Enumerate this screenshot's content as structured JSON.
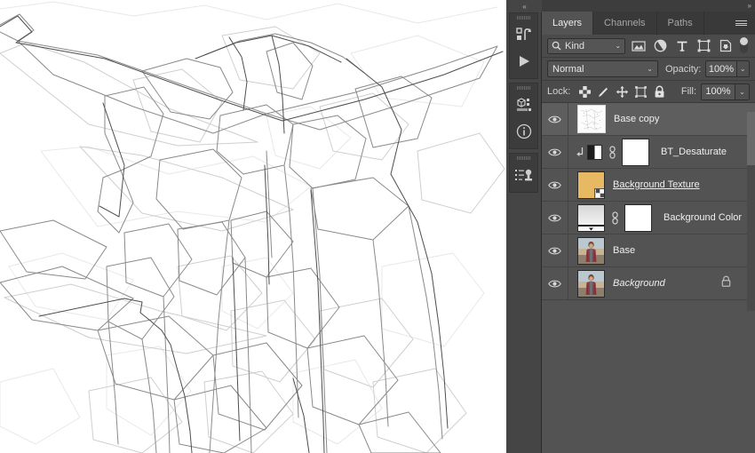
{
  "app": {
    "name": "Adobe Photoshop",
    "accent": "#535353"
  },
  "canvas": {
    "name": "document-canvas",
    "background_color": "#ffffff",
    "artwork_description": "Low-poly polygonal line-art sketch of a figure with outstretched arms",
    "line_color": "#5a5a5a"
  },
  "rail": {
    "collapse_glyph": "«",
    "groups": [
      {
        "name": "history-actions-group",
        "buttons": [
          {
            "name": "history-icon",
            "label": "History"
          },
          {
            "name": "play-icon",
            "label": "Play Action"
          }
        ]
      },
      {
        "name": "properties-info-group",
        "buttons": [
          {
            "name": "properties-icon",
            "label": "Properties"
          },
          {
            "name": "info-icon",
            "label": "Info"
          }
        ]
      },
      {
        "name": "layer-comps-group",
        "buttons": [
          {
            "name": "layer-comps-icon",
            "label": "Layer Comps"
          }
        ]
      }
    ]
  },
  "panel": {
    "collapse_glyph": "»",
    "menu_label": "Panel Menu",
    "tabs": [
      {
        "label": "Layers",
        "active": true
      },
      {
        "label": "Channels",
        "active": false
      },
      {
        "label": "Paths",
        "active": false
      }
    ],
    "filter": {
      "kind_label": "Kind",
      "search_icon": "search-icon",
      "chevron": "⌄",
      "icons": [
        {
          "name": "filter-pixel-icon",
          "label": "Filter for pixel layers"
        },
        {
          "name": "filter-adjustment-icon",
          "label": "Filter for adjustment layers"
        },
        {
          "name": "filter-type-icon",
          "label": "Filter for type layers"
        },
        {
          "name": "filter-shape-icon",
          "label": "Filter for shape layers"
        },
        {
          "name": "filter-smartobject-icon",
          "label": "Filter for smart objects"
        }
      ],
      "toggle_label": "Turn layer filtering on/off",
      "toggle_on": false
    },
    "blend": {
      "mode": "Normal",
      "opacity_label": "Opacity:",
      "opacity_value": "100%",
      "chevron": "⌄"
    },
    "lock": {
      "label": "Lock:",
      "fill_label": "Fill:",
      "fill_value": "100%",
      "chevron": "⌄",
      "icons": [
        {
          "name": "lock-transparent-pixels-icon",
          "label": "Lock transparent pixels"
        },
        {
          "name": "lock-image-pixels-icon",
          "label": "Lock image pixels"
        },
        {
          "name": "lock-position-icon",
          "label": "Lock position"
        },
        {
          "name": "lock-artboard-nesting-icon",
          "label": "Prevent auto-nesting"
        },
        {
          "name": "lock-all-icon",
          "label": "Lock all"
        }
      ]
    },
    "layers": [
      {
        "name": "Base copy",
        "visible": true,
        "selected": true,
        "thumb_type": "sketch",
        "italic": false,
        "underline": false,
        "clipped": false,
        "has_mask": false,
        "linked": false,
        "locked": false,
        "smart_object": false
      },
      {
        "name": "BT_Desaturate",
        "visible": true,
        "selected": false,
        "thumb_type": "adjustment",
        "italic": false,
        "underline": false,
        "clipped": true,
        "has_mask": true,
        "linked": true,
        "locked": false,
        "smart_object": false
      },
      {
        "name": "Background Texture ",
        "visible": true,
        "selected": false,
        "thumb_type": "texture",
        "thumb_color": "#e8b963",
        "italic": false,
        "underline": true,
        "clipped": false,
        "has_mask": false,
        "linked": false,
        "locked": false,
        "smart_object": true
      },
      {
        "name": "Background Color",
        "visible": true,
        "selected": false,
        "thumb_type": "gradient",
        "italic": false,
        "underline": false,
        "clipped": false,
        "has_mask": true,
        "linked": true,
        "locked": false,
        "smart_object": false
      },
      {
        "name": "Base",
        "visible": true,
        "selected": false,
        "thumb_type": "photo",
        "italic": false,
        "underline": false,
        "clipped": false,
        "has_mask": false,
        "linked": false,
        "locked": false,
        "smart_object": false
      },
      {
        "name": "Background",
        "visible": true,
        "selected": false,
        "thumb_type": "photo",
        "italic": true,
        "underline": false,
        "clipped": false,
        "has_mask": false,
        "linked": false,
        "locked": true,
        "smart_object": false
      }
    ]
  }
}
